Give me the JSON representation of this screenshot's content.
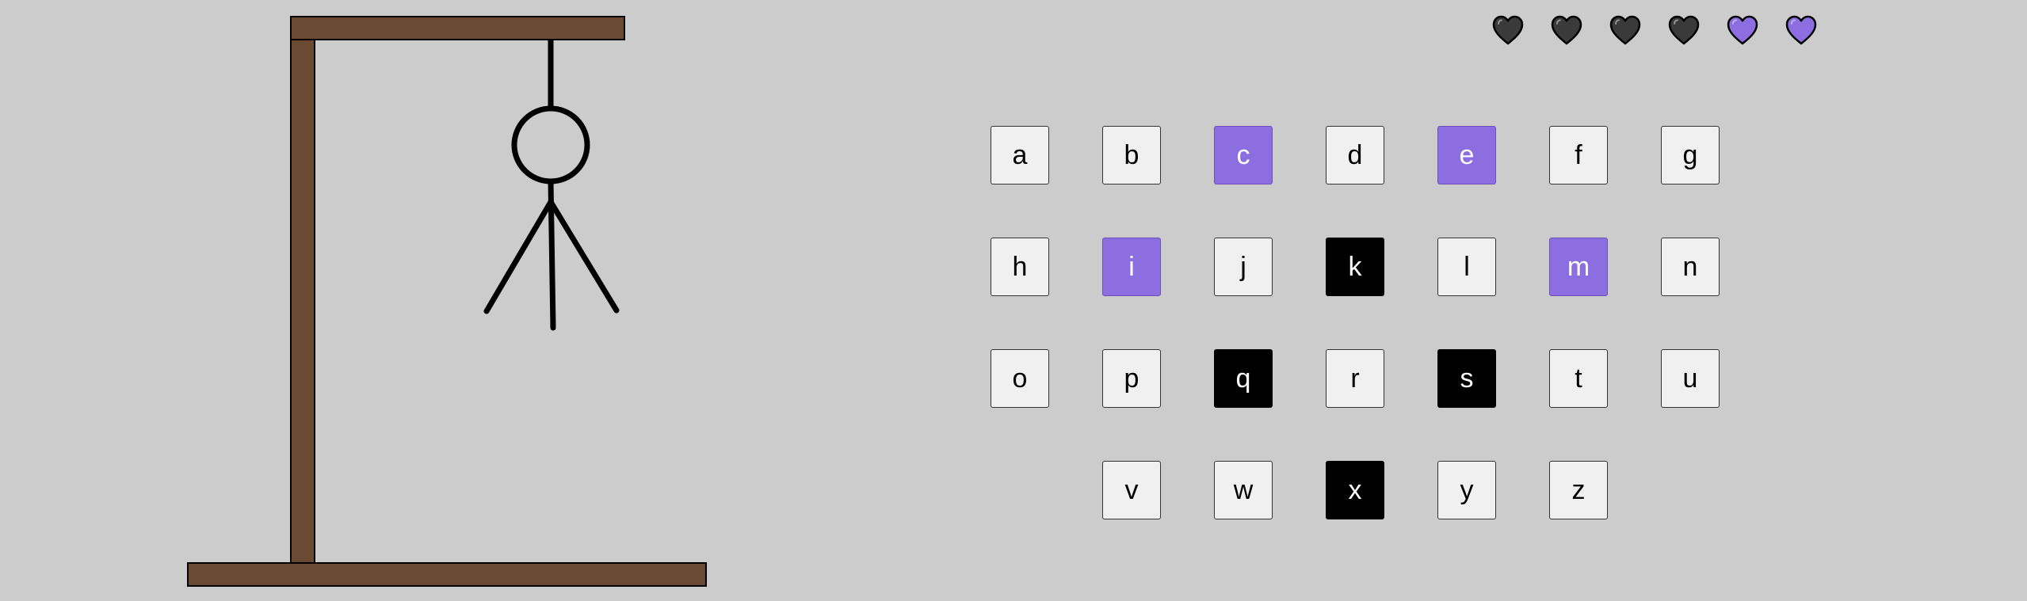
{
  "colors": {
    "background": "#cccccc",
    "wood": "#6b4a34",
    "key_default": "#f0f0f0",
    "key_correct": "#8c6ee0",
    "key_wrong": "#000000",
    "heart_full": "#8c6ee0",
    "heart_lost": "#3a3a3a"
  },
  "game": {
    "lives_total": 6,
    "lives_remaining": 2,
    "hangman_parts_shown": [
      "head",
      "body",
      "left-arm",
      "right-arm"
    ]
  },
  "hearts": [
    {
      "state": "lost",
      "icon": "heart-icon"
    },
    {
      "state": "lost",
      "icon": "heart-icon"
    },
    {
      "state": "lost",
      "icon": "heart-icon"
    },
    {
      "state": "lost",
      "icon": "heart-icon"
    },
    {
      "state": "full",
      "icon": "heart-icon"
    },
    {
      "state": "full",
      "icon": "heart-icon"
    }
  ],
  "keyboard": {
    "keys": [
      {
        "letter": "a",
        "state": "default"
      },
      {
        "letter": "b",
        "state": "default"
      },
      {
        "letter": "c",
        "state": "correct"
      },
      {
        "letter": "d",
        "state": "default"
      },
      {
        "letter": "e",
        "state": "correct"
      },
      {
        "letter": "f",
        "state": "default"
      },
      {
        "letter": "g",
        "state": "default"
      },
      {
        "letter": "h",
        "state": "default"
      },
      {
        "letter": "i",
        "state": "correct"
      },
      {
        "letter": "j",
        "state": "default"
      },
      {
        "letter": "k",
        "state": "wrong"
      },
      {
        "letter": "l",
        "state": "default"
      },
      {
        "letter": "m",
        "state": "correct"
      },
      {
        "letter": "n",
        "state": "default"
      },
      {
        "letter": "o",
        "state": "default"
      },
      {
        "letter": "p",
        "state": "default"
      },
      {
        "letter": "q",
        "state": "wrong"
      },
      {
        "letter": "r",
        "state": "default"
      },
      {
        "letter": "s",
        "state": "wrong"
      },
      {
        "letter": "t",
        "state": "default"
      },
      {
        "letter": "u",
        "state": "default"
      },
      {
        "letter": "v",
        "state": "default"
      },
      {
        "letter": "w",
        "state": "default"
      },
      {
        "letter": "x",
        "state": "wrong"
      },
      {
        "letter": "y",
        "state": "default"
      },
      {
        "letter": "z",
        "state": "default"
      }
    ]
  }
}
